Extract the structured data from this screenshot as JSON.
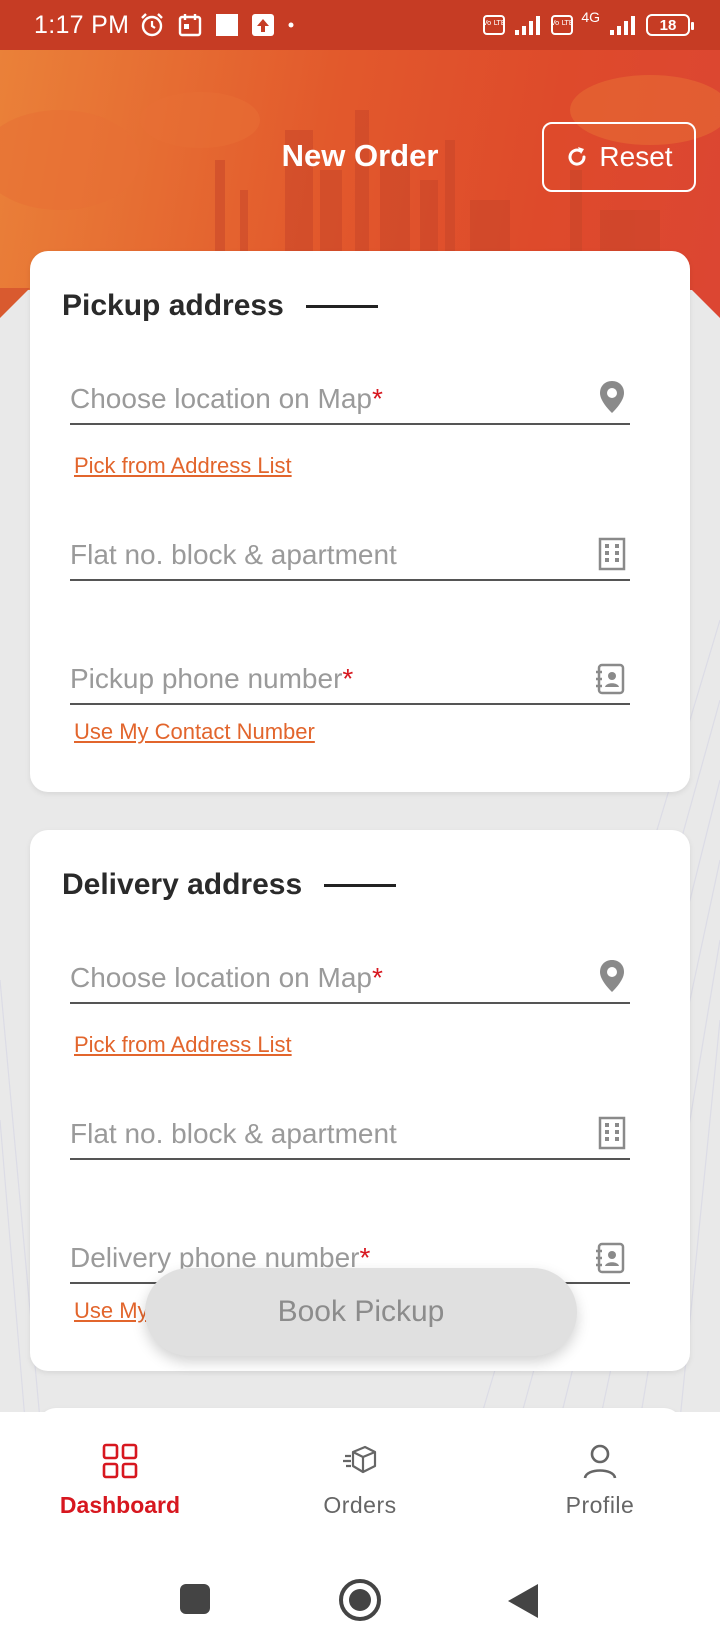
{
  "status_bar": {
    "time": "1:17 PM",
    "battery": "18",
    "network": "4G",
    "volte_1": "Vo LTE",
    "volte_2": "Vo LTE"
  },
  "header": {
    "title": "New Order",
    "reset_label": "Reset"
  },
  "pickup": {
    "title": "Pickup address",
    "location_placeholder": "Choose location on Map",
    "location_required": "*",
    "address_list_link": "Pick from Address List",
    "flat_placeholder": "Flat no. block & apartment",
    "phone_placeholder": "Pickup phone number",
    "phone_required": "*",
    "contact_link": "Use My Contact Number"
  },
  "delivery": {
    "title": "Delivery address",
    "location_placeholder": "Choose location on Map",
    "location_required": "*",
    "address_list_link": "Pick from Address List",
    "flat_placeholder": "Flat no. block & apartment",
    "phone_placeholder": "Delivery phone number",
    "phone_required": "*",
    "contact_link": "Use My"
  },
  "book_button": "Book Pickup",
  "bottom_nav": {
    "items": [
      {
        "label": "Dashboard",
        "icon": "dashboard-grid-icon",
        "active": true
      },
      {
        "label": "Orders",
        "icon": "orders-box-icon",
        "active": false
      },
      {
        "label": "Profile",
        "icon": "profile-person-icon",
        "active": false
      }
    ]
  },
  "colors": {
    "accent_red": "#d7171f",
    "link_orange": "#e2652c",
    "header_start": "#ea8139",
    "header_end": "#dc4632",
    "status_bar": "#c63c24"
  }
}
